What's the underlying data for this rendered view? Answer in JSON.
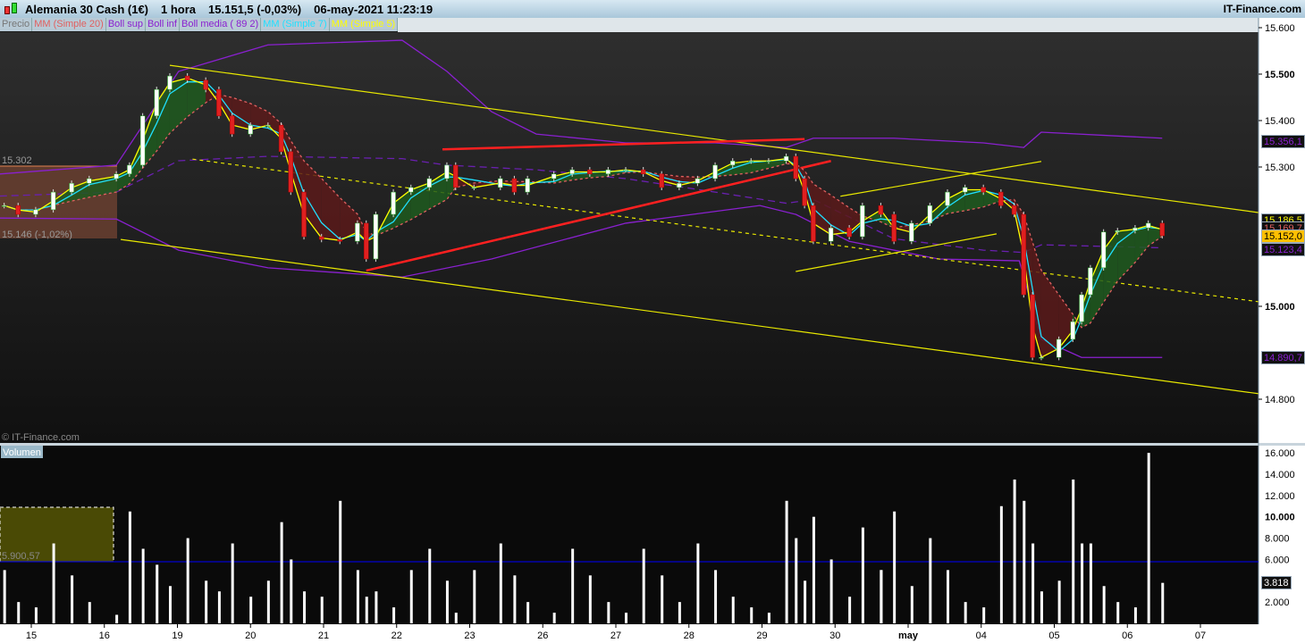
{
  "header": {
    "instrument": "Alemania 30 Cash (1€)",
    "timeframe": "1 hora",
    "last": "15.151,5 (-0,03%)",
    "datetime": "06-may-2021 11:23:19",
    "brand": "IT-Finance.com"
  },
  "legend": [
    {
      "label": "Precio",
      "color": "#777777"
    },
    {
      "label": "MM (Simple 20)",
      "color": "#e06060"
    },
    {
      "label": "Boll sup",
      "color": "#8a20d0"
    },
    {
      "label": "Boll inf",
      "color": "#8a20d0"
    },
    {
      "label": "Boll media ( 89 2)",
      "color": "#8a20d0"
    },
    {
      "label": "MM (Simple 7)",
      "color": "#20e0ff"
    },
    {
      "label": "MM (Simple 5)",
      "color": "#ffff00"
    }
  ],
  "watermark": "© IT-Finance.com",
  "range_box": {
    "high": "15.302",
    "low": "15.146 (-1,02%)"
  },
  "volume_panel": {
    "title": "Volumen",
    "box_value": "5.900,57",
    "last_tag": "3.818",
    "ticks": [
      "16.000",
      "14.000",
      "12.000",
      "10.000",
      "8.000",
      "6.000",
      "2.000"
    ]
  },
  "price_tags": [
    {
      "text": "15.356,1",
      "color": "#8a20d0",
      "price": 15356.1
    },
    {
      "text": "15.186,5",
      "color": "#ffff00",
      "price": 15186.5
    },
    {
      "text": "15.169,7",
      "color": "#e06060",
      "price": 15169.7
    },
    {
      "text": "15.152,0",
      "color": "#000000",
      "bg": "#ffc000",
      "price": 15152.0
    },
    {
      "text": "15.123,4",
      "color": "#8a20d0",
      "price": 15123.4
    },
    {
      "text": "14.890,7",
      "color": "#8a20d0",
      "price": 14890.7
    }
  ],
  "chart_data": {
    "type": "candlestick",
    "ylim": [
      14750,
      15620
    ],
    "y_ticks": [
      "15.600",
      "15.500",
      "15.400",
      "15.300",
      "15.000",
      "14.800"
    ],
    "x_ticks": [
      "15",
      "16",
      "19",
      "20",
      "21",
      "22",
      "23",
      "26",
      "27",
      "28",
      "29",
      "30",
      "may",
      "04",
      "05",
      "06",
      "07"
    ],
    "close": [
      [
        -0.37,
        15217
      ],
      [
        -0.18,
        15198
      ],
      [
        0.06,
        15208
      ],
      [
        0.3,
        15246
      ],
      [
        0.55,
        15265
      ],
      [
        0.79,
        15275
      ],
      [
        1.16,
        15285
      ],
      [
        1.34,
        15304
      ],
      [
        1.52,
        15410
      ],
      [
        1.71,
        15467
      ],
      [
        1.89,
        15496
      ],
      [
        2.13,
        15487
      ],
      [
        2.38,
        15467
      ],
      [
        2.56,
        15410
      ],
      [
        2.74,
        15371
      ],
      [
        2.99,
        15390
      ],
      [
        3.23,
        15390
      ],
      [
        3.41,
        15333
      ],
      [
        3.54,
        15246
      ],
      [
        3.72,
        15150
      ],
      [
        3.96,
        15144
      ],
      [
        4.21,
        15140
      ],
      [
        4.45,
        15179
      ],
      [
        4.57,
        15102
      ],
      [
        4.7,
        15198
      ],
      [
        4.94,
        15246
      ],
      [
        5.18,
        15256
      ],
      [
        5.43,
        15275
      ],
      [
        5.67,
        15304
      ],
      [
        5.79,
        15256
      ],
      [
        6.04,
        15256
      ],
      [
        6.4,
        15275
      ],
      [
        6.59,
        15246
      ],
      [
        6.77,
        15275
      ],
      [
        7.13,
        15285
      ],
      [
        7.38,
        15294
      ],
      [
        7.62,
        15285
      ],
      [
        7.87,
        15294
      ],
      [
        8.11,
        15294
      ],
      [
        8.35,
        15285
      ],
      [
        8.6,
        15256
      ],
      [
        8.84,
        15265
      ],
      [
        9.09,
        15275
      ],
      [
        9.33,
        15304
      ],
      [
        9.57,
        15313
      ],
      [
        9.82,
        15313
      ],
      [
        10.06,
        15313
      ],
      [
        10.3,
        15323
      ],
      [
        10.43,
        15275
      ],
      [
        10.55,
        15217
      ],
      [
        10.67,
        15140
      ],
      [
        10.91,
        15169
      ],
      [
        11.16,
        15150
      ],
      [
        11.34,
        15217
      ],
      [
        11.59,
        15198
      ],
      [
        11.77,
        15140
      ],
      [
        12.01,
        15179
      ],
      [
        12.26,
        15217
      ],
      [
        12.5,
        15246
      ],
      [
        12.74,
        15256
      ],
      [
        12.99,
        15246
      ],
      [
        13.23,
        15217
      ],
      [
        13.41,
        15198
      ],
      [
        13.54,
        15025
      ],
      [
        13.66,
        14890
      ],
      [
        13.78,
        14890
      ],
      [
        14.02,
        14929
      ],
      [
        14.21,
        14967
      ],
      [
        14.33,
        15025
      ],
      [
        14.45,
        15083
      ],
      [
        14.63,
        15160
      ],
      [
        14.82,
        15163
      ],
      [
        15.06,
        15169
      ],
      [
        15.24,
        15179
      ],
      [
        15.43,
        15152
      ]
    ],
    "volume": [
      [
        -0.37,
        5000
      ],
      [
        -0.18,
        2000
      ],
      [
        0.06,
        1500
      ],
      [
        0.3,
        7500
      ],
      [
        0.55,
        4500
      ],
      [
        0.79,
        2000
      ],
      [
        1.16,
        800
      ],
      [
        1.34,
        10500
      ],
      [
        1.52,
        7000
      ],
      [
        1.71,
        5500
      ],
      [
        1.89,
        3500
      ],
      [
        2.13,
        8000
      ],
      [
        2.38,
        4000
      ],
      [
        2.56,
        3000
      ],
      [
        2.74,
        7500
      ],
      [
        2.99,
        2500
      ],
      [
        3.23,
        4000
      ],
      [
        3.41,
        9500
      ],
      [
        3.54,
        6000
      ],
      [
        3.72,
        3000
      ],
      [
        3.96,
        2500
      ],
      [
        4.21,
        11500
      ],
      [
        4.45,
        5000
      ],
      [
        4.57,
        2500
      ],
      [
        4.7,
        3000
      ],
      [
        4.94,
        1500
      ],
      [
        5.18,
        5000
      ],
      [
        5.43,
        7000
      ],
      [
        5.67,
        4000
      ],
      [
        5.79,
        1000
      ],
      [
        6.04,
        5000
      ],
      [
        6.4,
        7500
      ],
      [
        6.59,
        4500
      ],
      [
        6.77,
        2000
      ],
      [
        7.13,
        1000
      ],
      [
        7.38,
        7000
      ],
      [
        7.62,
        4500
      ],
      [
        7.87,
        2000
      ],
      [
        8.11,
        1000
      ],
      [
        8.35,
        7000
      ],
      [
        8.6,
        4500
      ],
      [
        8.84,
        2000
      ],
      [
        9.09,
        7500
      ],
      [
        9.33,
        5000
      ],
      [
        9.57,
        2500
      ],
      [
        9.82,
        1500
      ],
      [
        10.06,
        1000
      ],
      [
        10.3,
        11500
      ],
      [
        10.43,
        8000
      ],
      [
        10.55,
        4000
      ],
      [
        10.67,
        10000
      ],
      [
        10.91,
        6000
      ],
      [
        11.16,
        2500
      ],
      [
        11.34,
        9000
      ],
      [
        11.59,
        5000
      ],
      [
        11.77,
        10500
      ],
      [
        11.59,
        5000
      ],
      [
        12.01,
        3500
      ],
      [
        12.26,
        8000
      ],
      [
        12.5,
        5000
      ],
      [
        12.74,
        2000
      ],
      [
        12.99,
        1500
      ],
      [
        13.23,
        11000
      ],
      [
        13.41,
        13500
      ],
      [
        13.54,
        11500
      ],
      [
        13.66,
        7500
      ],
      [
        13.78,
        3000
      ],
      [
        14.02,
        4000
      ],
      [
        14.21,
        13500
      ],
      [
        14.33,
        7500
      ],
      [
        14.45,
        7500
      ],
      [
        14.63,
        3500
      ],
      [
        14.82,
        2000
      ],
      [
        15.06,
        1500
      ],
      [
        15.24,
        16000
      ],
      [
        15.43,
        3800
      ]
    ],
    "boll_sup": [
      [
        -0.43,
        15285
      ],
      [
        1.16,
        15304
      ],
      [
        2.01,
        15506
      ],
      [
        3.23,
        15563
      ],
      [
        5.06,
        15573
      ],
      [
        5.67,
        15506
      ],
      [
        6.28,
        15419
      ],
      [
        6.89,
        15371
      ],
      [
        8.11,
        15352
      ],
      [
        9.33,
        15352
      ],
      [
        10.3,
        15342
      ],
      [
        10.67,
        15362
      ],
      [
        11.77,
        15362
      ],
      [
        12.99,
        15352
      ],
      [
        13.54,
        15342
      ],
      [
        13.78,
        15375
      ],
      [
        15.43,
        15362
      ]
    ],
    "boll_inf": [
      [
        -0.43,
        15190
      ],
      [
        1.16,
        15188
      ],
      [
        2.01,
        15121
      ],
      [
        3.23,
        15083
      ],
      [
        5.06,
        15063
      ],
      [
        6.28,
        15102
      ],
      [
        8.11,
        15179
      ],
      [
        9.94,
        15217
      ],
      [
        10.43,
        15198
      ],
      [
        11.16,
        15140
      ],
      [
        12.38,
        15102
      ],
      [
        13.48,
        15098
      ],
      [
        13.78,
        14929
      ],
      [
        14.33,
        14890
      ],
      [
        15.43,
        14890
      ]
    ],
    "trendlines": [
      {
        "color": "#e8e800",
        "dash": false,
        "from": [
          1.89,
          15519
        ],
        "to": [
          16.74,
          15202
        ]
      },
      {
        "color": "#e8e800",
        "dash": false,
        "from": [
          1.22,
          15144
        ],
        "to": [
          16.74,
          14812
        ]
      },
      {
        "color": "#e8e800",
        "dash": true,
        "from": [
          2.2,
          15317
        ],
        "to": [
          16.74,
          15010
        ]
      },
      {
        "color": "#ff2020",
        "dash": false,
        "from": [
          4.57,
          15077
        ],
        "to": [
          10.91,
          15313
        ]
      },
      {
        "color": "#ff2020",
        "dash": false,
        "from": [
          5.61,
          15338
        ],
        "to": [
          10.55,
          15360
        ]
      },
      {
        "color": "#e8e800",
        "dash": false,
        "from": [
          11.04,
          15237
        ],
        "to": [
          13.78,
          15312
        ]
      },
      {
        "color": "#e8e800",
        "dash": false,
        "from": [
          10.43,
          15075
        ],
        "to": [
          13.17,
          15156
        ]
      }
    ]
  }
}
